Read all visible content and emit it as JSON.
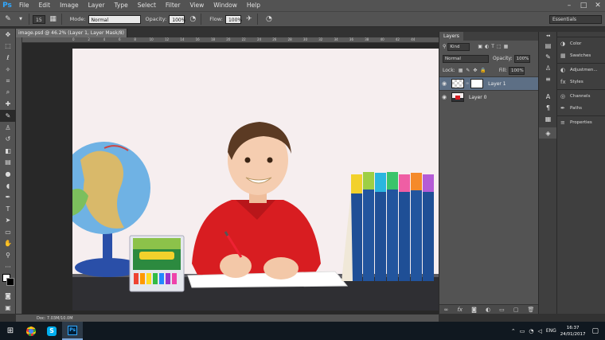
{
  "app": {
    "logo": "Ps"
  },
  "menu": [
    "File",
    "Edit",
    "Image",
    "Layer",
    "Type",
    "Select",
    "Filter",
    "View",
    "Window",
    "Help"
  ],
  "window_controls": {
    "minimize": "–",
    "maximize": "□",
    "close": "✕"
  },
  "options_bar": {
    "brush_size": "15",
    "mode_label": "Mode:",
    "mode_value": "Normal",
    "opacity_label": "Opacity:",
    "opacity_value": "100%",
    "flow_label": "Flow:",
    "flow_value": "100%",
    "workspace": "Essentials"
  },
  "document": {
    "tab_title": "image.psd @ 46.2% (Layer 1, Layer Mask/8) *",
    "status_doc": "Doc: 7.03M/10.0M",
    "ruler_marks": [
      "0",
      "2",
      "4",
      "6",
      "8",
      "10",
      "12",
      "14",
      "16",
      "18",
      "20",
      "22",
      "24",
      "26",
      "28",
      "30",
      "32",
      "34",
      "36",
      "38",
      "40",
      "42",
      "44"
    ]
  },
  "layers_panel": {
    "tab_label": "Layers",
    "kind_label": "Kind",
    "blend_mode": "Normal",
    "opacity_label": "Opacity:",
    "opacity_value": "100%",
    "lock_label": "Lock:",
    "fill_label": "Fill:",
    "fill_value": "100%",
    "layers": [
      {
        "name": "Layer 1",
        "selected": true
      },
      {
        "name": "Layer 0",
        "selected": false
      }
    ]
  },
  "right_panels": {
    "groups": [
      [
        "Color",
        "Swatches"
      ],
      [
        "Adjustmen...",
        "Styles"
      ],
      [
        "Channels",
        "Paths"
      ],
      [
        "Properties"
      ]
    ]
  },
  "taskbar": {
    "language": "ENG",
    "time": "16:37",
    "date": "24/01/2017"
  },
  "colors": {
    "accent": "#31a8ff",
    "selected_layer": "#5d6f85",
    "panel_bg": "#535353"
  }
}
